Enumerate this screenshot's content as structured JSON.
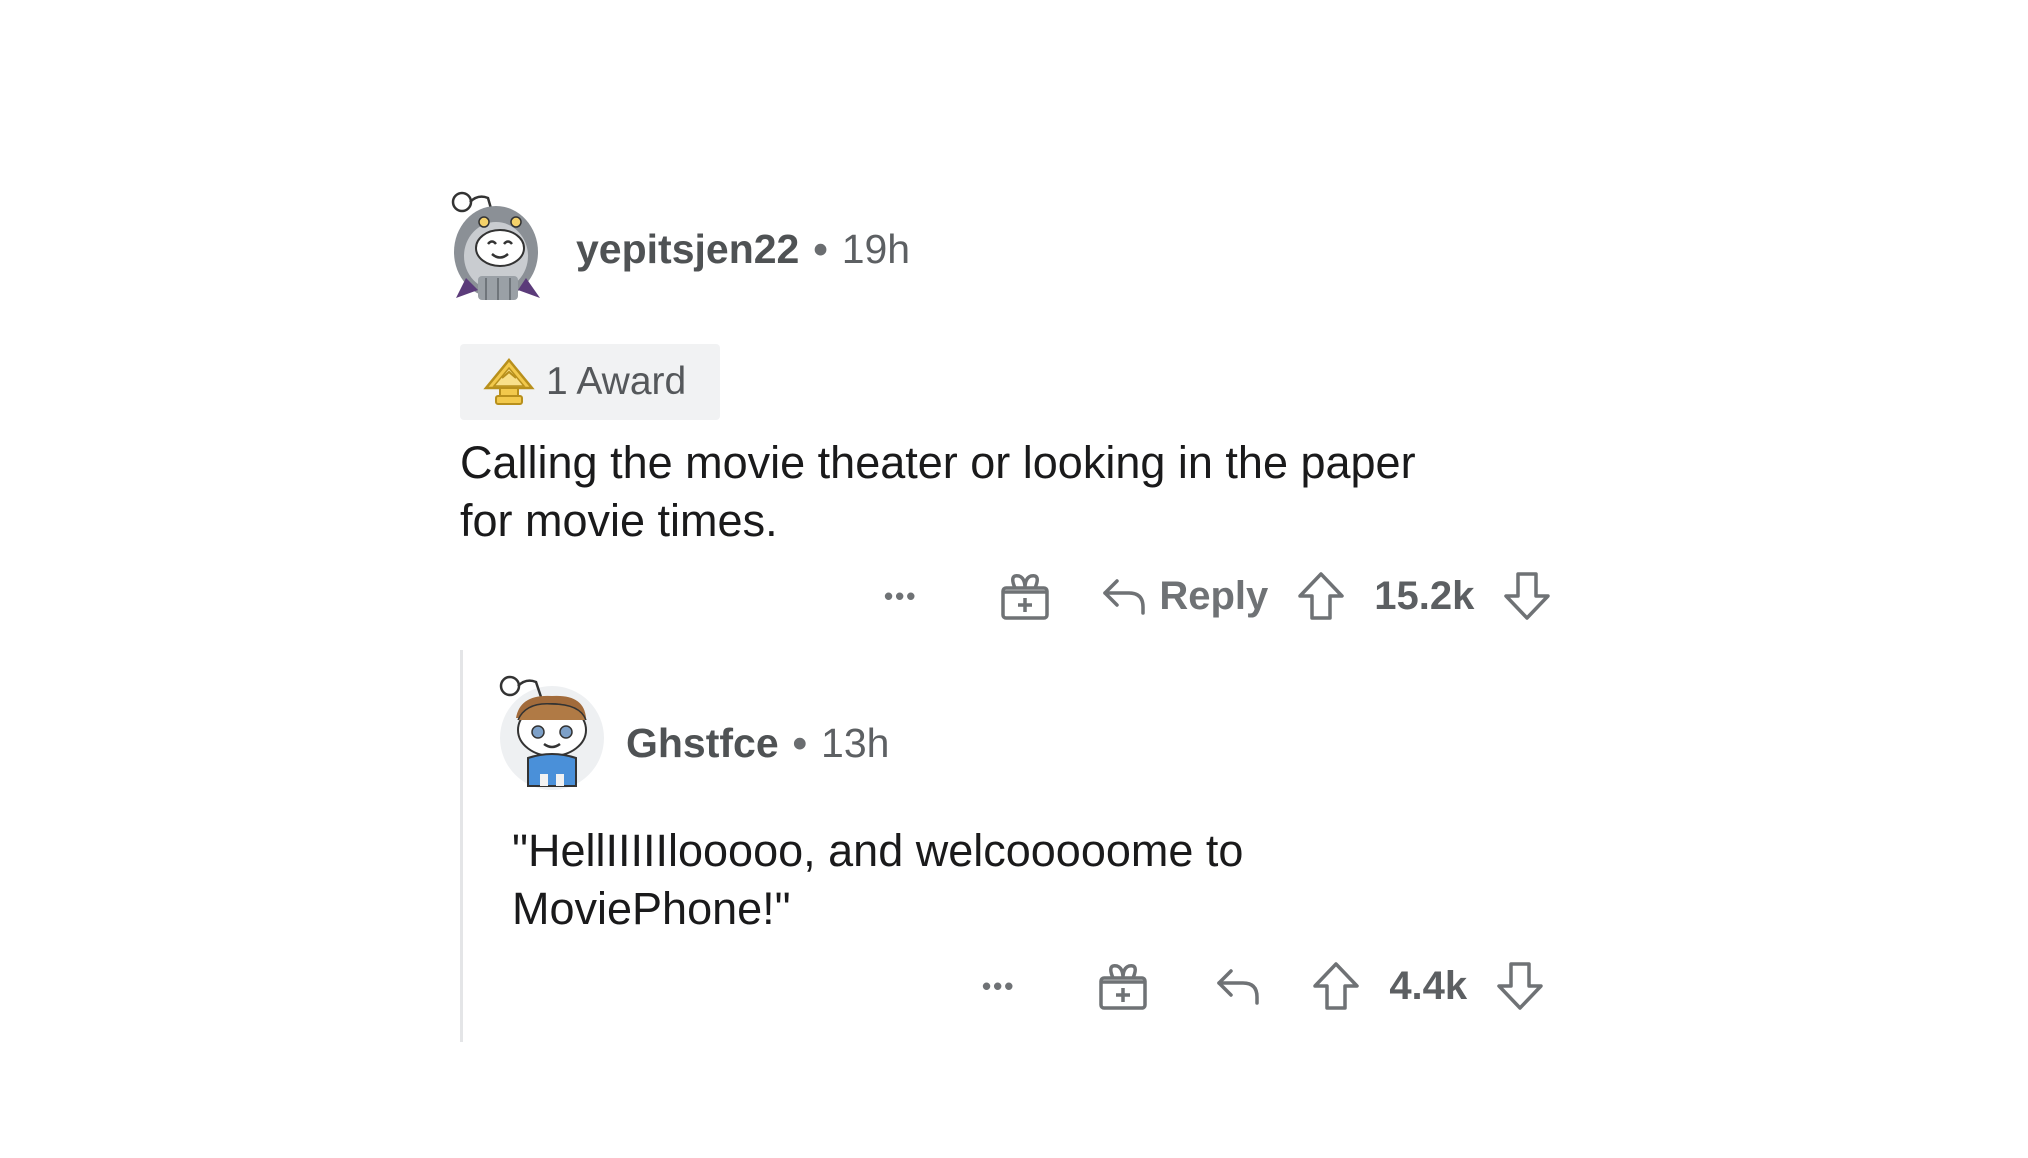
{
  "comments": [
    {
      "username": "yepitsjen22",
      "separator": "•",
      "time": "19h",
      "award": {
        "label": "1 Award",
        "icon": "gold-award-icon"
      },
      "body_lines": [
        "Calling the movie theater or looking in the paper",
        "for movie times."
      ],
      "actions": {
        "more_label": "•••",
        "reply_label": "Reply",
        "score": "15.2k"
      }
    },
    {
      "username": "Ghstfce",
      "separator": "•",
      "time": "13h",
      "body_lines": [
        "\"HellIIIIIlooooo, and welcooooome to",
        "MoviePhone!\""
      ],
      "actions": {
        "more_label": "•••",
        "score": "4.4k"
      }
    }
  ],
  "colors": {
    "text": "#1a1a1b",
    "meta": "#5d6063",
    "icon": "#6f7275",
    "thread_line": "#e4e5e7",
    "award_chip": "#f1f2f3",
    "award_gold": "#f2c94c"
  }
}
